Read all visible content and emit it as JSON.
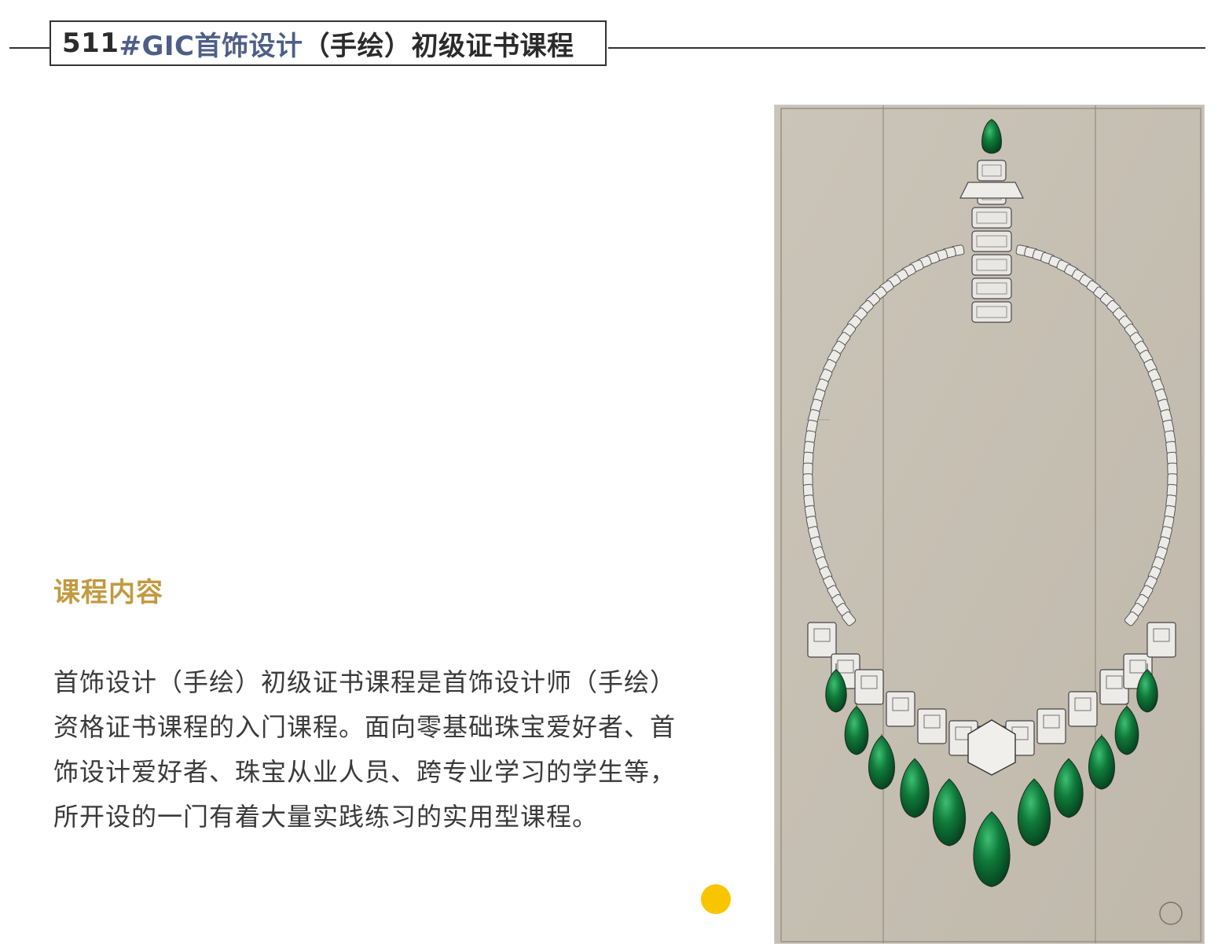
{
  "header": {
    "number": "511",
    "accent": "#GIC首饰设计",
    "rest": "（手绘）初级证书课程"
  },
  "section": {
    "heading": "课程内容",
    "body": "首饰设计（手绘）初级证书课程是首饰设计师（手绘）资格证书课程的入门课程。面向零基础珠宝爱好者、首饰设计爱好者、珠宝从业人员、跨专业学习的学生等，所开设的一门有着大量实践练习的实用型课程。"
  },
  "image": {
    "subject": "emerald-necklace-sketch"
  },
  "colors": {
    "heading": "#c29a41",
    "title_accent": "#4d5f88",
    "emerald": "#0f7a3a",
    "paper": "#c8c0b4",
    "dot": "#f9c400"
  }
}
